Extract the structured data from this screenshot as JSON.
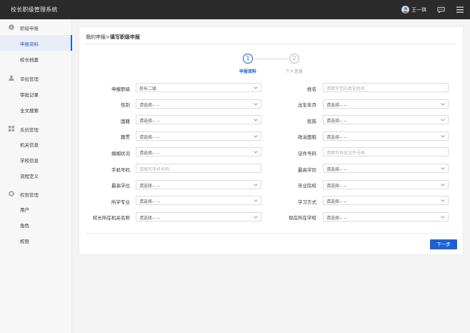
{
  "app": {
    "title": "校长职级管理系统"
  },
  "header": {
    "user_name": "王一琪"
  },
  "sidebar": {
    "groups": [
      {
        "icon": "info-circle-icon",
        "label": "职级申报",
        "items": [
          {
            "label": "申报资料",
            "active": true
          },
          {
            "label": "校长档案",
            "active": false
          }
        ]
      },
      {
        "icon": "user-icon",
        "label": "审批管理",
        "items": [
          {
            "label": "审批记录",
            "active": false
          },
          {
            "label": "全文搜索",
            "active": false
          }
        ]
      },
      {
        "icon": "grid-icon",
        "label": "系统管理",
        "items": [
          {
            "label": "机关信息",
            "active": false
          },
          {
            "label": "学校信息",
            "active": false
          },
          {
            "label": "流程定义",
            "active": false
          }
        ]
      },
      {
        "icon": "shield-icon",
        "label": "权限管理",
        "items": [
          {
            "label": "用户",
            "active": false
          },
          {
            "label": "角色",
            "active": false
          },
          {
            "label": "权限",
            "active": false
          }
        ]
      }
    ]
  },
  "main": {
    "breadcrumb": {
      "parent": "我的申报",
      "separator": ">",
      "current": "填写职级申报"
    },
    "steps": [
      {
        "number": "1",
        "label": "申报资料",
        "active": true
      },
      {
        "number": "2",
        "label": "个人信息",
        "active": false
      }
    ],
    "form": {
      "left": [
        {
          "label": "申报职级",
          "type": "select",
          "value": "校长二级"
        },
        {
          "label": "性别",
          "type": "select",
          "value": "请选择-- --"
        },
        {
          "label": "国籍",
          "type": "select",
          "value": "请选择-- --"
        },
        {
          "label": "籍贯",
          "type": "select",
          "value": "请选择-- --"
        },
        {
          "label": "婚姻状况",
          "type": "select",
          "value": "请选择-- --"
        },
        {
          "label": "手机号码",
          "type": "input",
          "placeholder": "请填写手机号码"
        },
        {
          "label": "最高学位",
          "type": "select",
          "value": "请选择-- --"
        },
        {
          "label": "所学专业",
          "type": "select",
          "value": "请选择-- --"
        },
        {
          "label": "校长所在机关名称",
          "type": "select",
          "value": "请选择-- --"
        }
      ],
      "right": [
        {
          "label": "姓名",
          "type": "input",
          "placeholder": "请填写您的真实姓名"
        },
        {
          "label": "出生年月",
          "type": "select",
          "value": "请选择-- --"
        },
        {
          "label": "民族",
          "type": "select",
          "value": "请选择-- --"
        },
        {
          "label": "政治面貌",
          "type": "select",
          "value": "请选择-- --"
        },
        {
          "label": "证件号码",
          "type": "input",
          "placeholder": "请填写有效证件号码"
        },
        {
          "label": "最高学历",
          "type": "select",
          "value": "请选择-- --"
        },
        {
          "label": "毕业院校",
          "type": "select",
          "value": "请选择-- --"
        },
        {
          "label": "学习方式",
          "type": "select",
          "value": "请选择-- --"
        },
        {
          "label": "现在所在学校",
          "type": "select",
          "value": "请选择-- --"
        }
      ]
    },
    "next_label": "下一步"
  },
  "colors": {
    "topbar": "#2b2b2b",
    "primary": "#1e5fd6",
    "sidebar_bg": "#f7f7f7",
    "page_bg": "#f3f3f3"
  }
}
